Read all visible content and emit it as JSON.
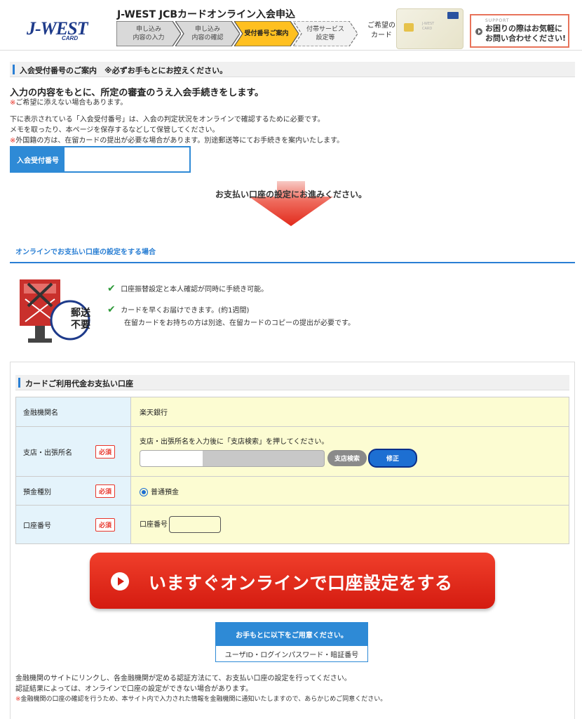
{
  "header": {
    "logo_text": "J-WEST",
    "logo_sub": "CARD",
    "title": "J-WEST JCBカードオンライン入会申込",
    "steps": [
      {
        "label": "申し込み\n内容の入力",
        "state": "done"
      },
      {
        "label": "申し込み\n内容の確認",
        "state": "done"
      },
      {
        "label": "受付番号ご案内",
        "state": "active"
      },
      {
        "label": "付帯サービス\n設定等",
        "state": "future"
      }
    ],
    "card_label": "ご希望の\nカード",
    "card_text": "J-WEST\nCARD",
    "support_small": "SUPPORT",
    "support_text": "お困りの際はお気軽に\nお問い合わせください!",
    "colors": {
      "active_step": "#ffc020",
      "done_step": "#d9d9d9",
      "brand": "#1d3a8a"
    }
  },
  "receipt": {
    "section_title": "入会受付番号のご案内　※必ずお手もとにお控えください。",
    "lead": "入力の内容をもとに、所定の審査のうえ入会手続きをします。",
    "lead_note": "ご希望に添えない場合もあります。",
    "para1": "下に表示されている「入会受付番号」は、入会の判定状況をオンラインで確認するために必要です。",
    "para2": "メモを取ったり、本ページを保存するなどして保管してください。",
    "para3": "外国籍の方は、在留カードの提出が必要な場合があります。別途郵送等にてお手続きを案内いたします。",
    "number_label": "入会受付番号",
    "number_value": ""
  },
  "proceed_text": "お支払い口座の設定にお進みください。",
  "online": {
    "title": "オンラインでお支払い口座の設定をする場合",
    "badge_text": "郵送\n不要",
    "benefit1": "口座振替設定と本人確認が同時に手続き可能。",
    "benefit2": "カードを早くお届けできます。(約1週間)",
    "benefit2_note": "在留カードをお持ちの方は別途、在留カードのコピーの提出が必要です。",
    "icons": [
      "check-icon",
      "postbox-icon"
    ]
  },
  "payment": {
    "section_title": "カードご利用代金お支払い口座",
    "rows": {
      "bank_label": "金融機関名",
      "bank_value": "楽天銀行",
      "branch_label": "支店・出張所名",
      "branch_hint": "支店・出張所名を入力後に「支店検索」を押してください。",
      "branch_value": "",
      "search_button": "支店検索",
      "fix_button": "修正",
      "type_label": "預金種別",
      "type_value": "普通預金",
      "acct_label": "口座番号",
      "acct_inline_label": "口座番号",
      "acct_value": "",
      "required": "必須"
    }
  },
  "cta": {
    "label": "いますぐオンラインで口座設定をする",
    "color": "#e22a1c"
  },
  "prepare": {
    "title": "お手もとに以下をご用意ください。",
    "items": "ユーザID・ログインパスワード・暗証番号"
  },
  "footer": {
    "line1": "金融機関のサイトにリンクし、各金融機関が定める認証方法にて、お支払い口座の設定を行ってください。",
    "line2": "認証結果によっては、オンラインで口座の設定ができない場合があります。",
    "line3": "金融機関の口座の確認を行うため、本サイト内で入力された情報を金融機関に通知いたしますので、あらかじめご同意ください。"
  }
}
